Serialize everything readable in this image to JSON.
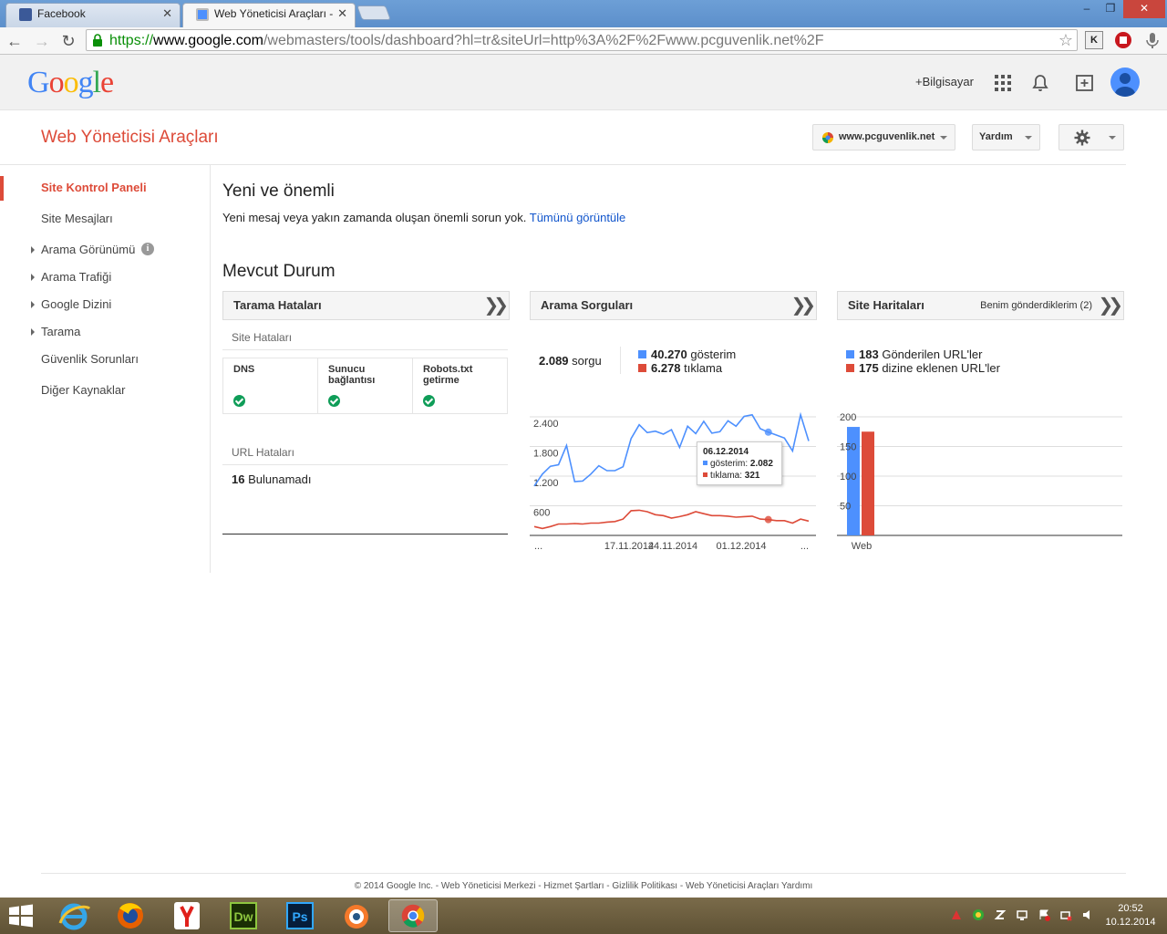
{
  "browser": {
    "tabs": [
      {
        "title": "Facebook",
        "favicon_color": "#3b5998"
      },
      {
        "title": "Web Yöneticisi Araçları - S",
        "favicon_color": "#4d90fe"
      }
    ],
    "url_scheme": "https://",
    "url_host": "www.google.com",
    "url_path": "/webmasters/tools/dashboard?hl=tr&siteUrl=http%3A%2F%2Fwww.pcguvenlik.net%2F",
    "extensions": [
      "K",
      "stop-icon",
      "mic-icon"
    ]
  },
  "google_header": {
    "logo_letters": [
      {
        "ch": "G",
        "color": "#4285f4"
      },
      {
        "ch": "o",
        "color": "#ea4335"
      },
      {
        "ch": "o",
        "color": "#fbbc05"
      },
      {
        "ch": "g",
        "color": "#4285f4"
      },
      {
        "ch": "l",
        "color": "#34a853"
      },
      {
        "ch": "e",
        "color": "#ea4335"
      }
    ],
    "plus_user": "+Bilgisayar"
  },
  "wmt": {
    "title": "Web Yöneticisi Araçları",
    "site_selector": "www.pcguvenlik.net",
    "help_button": "Yardım"
  },
  "sidebar": {
    "items": [
      {
        "label": "Site Kontrol Paneli",
        "active": true,
        "expandable": false
      },
      {
        "label": "Site Mesajları",
        "active": false,
        "expandable": false
      },
      {
        "label": "Arama Görünümü",
        "active": false,
        "expandable": true
      },
      {
        "label": "Arama Trafiği",
        "active": false,
        "expandable": true
      },
      {
        "label": "Google Dizini",
        "active": false,
        "expandable": true
      },
      {
        "label": "Tarama",
        "active": false,
        "expandable": true
      },
      {
        "label": "Güvenlik Sorunları",
        "active": false,
        "expandable": false
      },
      {
        "label": "Diğer Kaynaklar",
        "active": false,
        "expandable": false
      }
    ]
  },
  "news": {
    "heading": "Yeni ve önemli",
    "text": "Yeni mesaj veya yakın zamanda oluşan önemli sorun yok.",
    "link": "Tümünü görüntüle"
  },
  "status": {
    "heading": "Mevcut Durum",
    "crawl_errors": {
      "title": "Tarama Hataları",
      "site_errors_label": "Site Hataları",
      "columns": [
        {
          "line1": "DNS",
          "line2": "",
          "ok": true
        },
        {
          "line1": "Sunucu",
          "line2": "bağlantısı",
          "ok": true
        },
        {
          "line1": "Robots.txt",
          "line2": "getirme",
          "ok": true
        }
      ],
      "url_errors_label": "URL Hataları",
      "url_error_count": "16",
      "url_error_text": "Bulunamadı"
    },
    "search_queries": {
      "title": "Arama Sorguları",
      "queries_count": "2.089",
      "queries_label": "sorgu",
      "impressions_count": "40.270",
      "impressions_label": "gösterim",
      "clicks_count": "6.278",
      "clicks_label": "tıklama",
      "tooltip": {
        "date": "06.12.2014",
        "impressions_label": "gösterim:",
        "impressions_value": "2.082",
        "clicks_label": "tıklama:",
        "clicks_value": "321"
      }
    },
    "sitemaps": {
      "title": "Site Haritaları",
      "subtitle": "Benim gönderdiklerim (2)",
      "submitted_count": "183",
      "submitted_label": "Gönderilen URL'ler",
      "indexed_count": "175",
      "indexed_label": "dizine eklenen URL'ler"
    }
  },
  "chart_data": [
    {
      "type": "line",
      "x_tick_labels": [
        "...",
        "17.11.2014",
        "24.11.2014",
        "01.12.2014",
        "..."
      ],
      "y_tick_labels": [
        "2.400",
        "1.800",
        "1.200",
        "600"
      ],
      "ylim": [
        0,
        2400
      ],
      "colors": {
        "impressions": "#4d90fe",
        "clicks": "#dd4b39"
      },
      "series": [
        {
          "key": "impressions",
          "values": [
            1000,
            1240,
            1400,
            1430,
            1820,
            1090,
            1100,
            1240,
            1410,
            1310,
            1310,
            1390,
            1960,
            2240,
            2080,
            2110,
            2050,
            2140,
            1780,
            2210,
            2060,
            2310,
            2070,
            2100,
            2320,
            2210,
            2410,
            2440,
            2160,
            2090,
            2030,
            1970,
            1710,
            2440,
            1910
          ]
        },
        {
          "key": "clicks",
          "values": [
            180,
            140,
            180,
            230,
            230,
            240,
            230,
            250,
            250,
            270,
            280,
            330,
            500,
            510,
            480,
            420,
            400,
            350,
            380,
            420,
            480,
            440,
            400,
            400,
            390,
            370,
            380,
            390,
            330,
            320,
            300,
            300,
            250,
            330,
            290
          ]
        }
      ]
    },
    {
      "type": "bar",
      "categories": [
        "Web"
      ],
      "y_tick_labels": [
        "200",
        "150",
        "100",
        "50"
      ],
      "ylim": [
        0,
        200
      ],
      "series": [
        {
          "key": "submitted",
          "color": "#4d90fe",
          "values": [
            183
          ]
        },
        {
          "key": "indexed",
          "color": "#dd4b39",
          "values": [
            175
          ]
        }
      ]
    }
  ],
  "footer": {
    "text": "© 2014 Google Inc. - Web Yöneticisi Merkezi - Hizmet Şartları - Gizlilik Politikası - Web Yöneticisi Araçları Yardımı"
  },
  "taskbar": {
    "apps": [
      "ie-icon",
      "firefox-icon",
      "yandex-icon",
      "dreamweaver-icon",
      "photoshop-icon",
      "blender-icon",
      "chrome-icon"
    ],
    "dw_label": "Dw",
    "ps_label": "Ps",
    "time": "20:52",
    "date": "10.12.2014"
  }
}
